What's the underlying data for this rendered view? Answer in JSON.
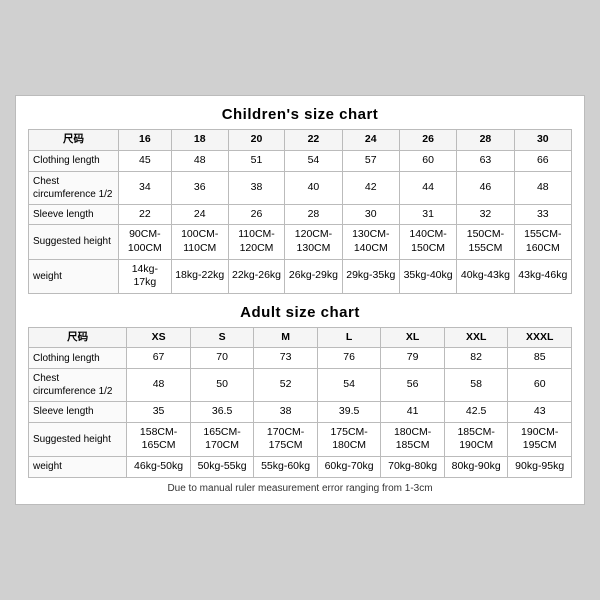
{
  "children_chart": {
    "title": "Children's size chart",
    "columns": [
      "尺码",
      "16",
      "18",
      "20",
      "22",
      "24",
      "26",
      "28",
      "30"
    ],
    "rows": [
      {
        "label": "Clothing length",
        "values": [
          "45",
          "48",
          "51",
          "54",
          "57",
          "60",
          "63",
          "66"
        ]
      },
      {
        "label": "Chest circumference 1/2",
        "values": [
          "34",
          "36",
          "38",
          "40",
          "42",
          "44",
          "46",
          "48"
        ]
      },
      {
        "label": "Sleeve length",
        "values": [
          "22",
          "24",
          "26",
          "28",
          "30",
          "31",
          "32",
          "33"
        ]
      },
      {
        "label": "Suggested height",
        "values": [
          "90CM-100CM",
          "100CM-110CM",
          "110CM-120CM",
          "120CM-130CM",
          "130CM-140CM",
          "140CM-150CM",
          "150CM-155CM",
          "155CM-160CM"
        ]
      },
      {
        "label": "weight",
        "values": [
          "14kg-17kg",
          "18kg-22kg",
          "22kg-26kg",
          "26kg-29kg",
          "29kg-35kg",
          "35kg-40kg",
          "40kg-43kg",
          "43kg-46kg"
        ]
      }
    ]
  },
  "adult_chart": {
    "title": "Adult size chart",
    "columns": [
      "尺码",
      "XS",
      "S",
      "M",
      "L",
      "XL",
      "XXL",
      "XXXL"
    ],
    "rows": [
      {
        "label": "Clothing length",
        "values": [
          "67",
          "70",
          "73",
          "76",
          "79",
          "82",
          "85"
        ]
      },
      {
        "label": "Chest circumference 1/2",
        "values": [
          "48",
          "50",
          "52",
          "54",
          "56",
          "58",
          "60"
        ]
      },
      {
        "label": "Sleeve length",
        "values": [
          "35",
          "36.5",
          "38",
          "39.5",
          "41",
          "42.5",
          "43"
        ]
      },
      {
        "label": "Suggested height",
        "values": [
          "158CM-165CM",
          "165CM-170CM",
          "170CM-175CM",
          "175CM-180CM",
          "180CM-185CM",
          "185CM-190CM",
          "190CM-195CM"
        ]
      },
      {
        "label": "weight",
        "values": [
          "46kg-50kg",
          "50kg-55kg",
          "55kg-60kg",
          "60kg-70kg",
          "70kg-80kg",
          "80kg-90kg",
          "90kg-95kg"
        ]
      }
    ]
  },
  "footnote": "Due to manual ruler measurement error ranging from 1-3cm"
}
